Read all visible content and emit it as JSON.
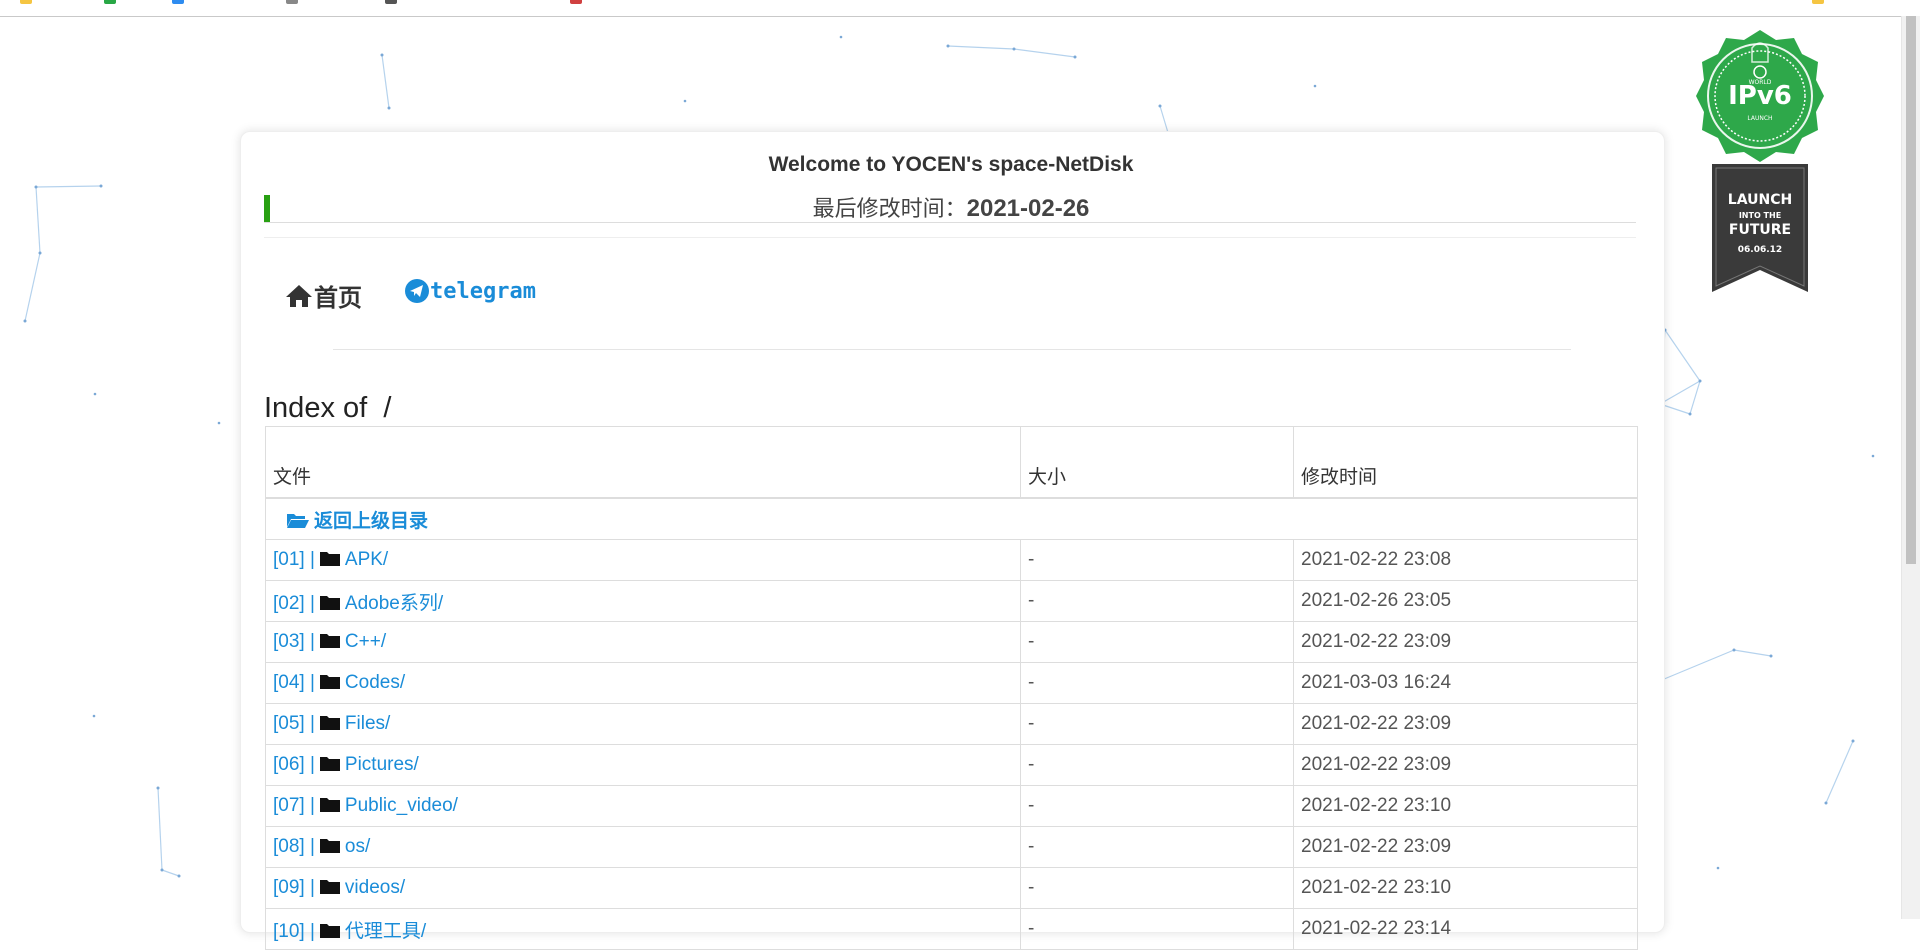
{
  "header": {
    "welcome": "Welcome to YOCEN's space-NetDisk",
    "modified_label": "最后修改时间：",
    "modified_date": "2021-02-26"
  },
  "nav": {
    "home_label": "首页",
    "telegram_label": "telegram"
  },
  "index": {
    "label": "Index of",
    "path": "/"
  },
  "table": {
    "columns": [
      "文件",
      "大小",
      "修改时间"
    ],
    "parent_label": "返回上级目录",
    "rows": [
      {
        "index": "[01] |",
        "name": "APK/",
        "size": "-",
        "modified": "2021-02-22 23:08"
      },
      {
        "index": "[02] |",
        "name": "Adobe系列/",
        "size": "-",
        "modified": "2021-02-26 23:05"
      },
      {
        "index": "[03] |",
        "name": "C++/",
        "size": "-",
        "modified": "2021-02-22 23:09"
      },
      {
        "index": "[04] |",
        "name": "Codes/",
        "size": "-",
        "modified": "2021-03-03 16:24"
      },
      {
        "index": "[05] |",
        "name": "Files/",
        "size": "-",
        "modified": "2021-02-22 23:09"
      },
      {
        "index": "[06] |",
        "name": "Pictures/",
        "size": "-",
        "modified": "2021-02-22 23:09"
      },
      {
        "index": "[07] |",
        "name": "Public_video/",
        "size": "-",
        "modified": "2021-02-22 23:10"
      },
      {
        "index": "[08] |",
        "name": "os/",
        "size": "-",
        "modified": "2021-02-22 23:09"
      },
      {
        "index": "[09] |",
        "name": "videos/",
        "size": "-",
        "modified": "2021-02-22 23:10"
      },
      {
        "index": "[10] |",
        "name": "代理工具/",
        "size": "-",
        "modified": "2021-02-22 23:14"
      }
    ]
  },
  "badge": {
    "top_text": "WORLD",
    "main_text": "IPv6",
    "sub_text": "LAUNCH",
    "ribbon_line1": "LAUNCH",
    "ribbon_line2": "INTO THE",
    "ribbon_line3": "FUTURE",
    "ribbon_date": "06.06.12"
  },
  "colors": {
    "link": "#1a8cd8",
    "accent_green": "#28a012",
    "badge_green": "#2ea84a",
    "badge_dark": "#3a3a3a"
  }
}
